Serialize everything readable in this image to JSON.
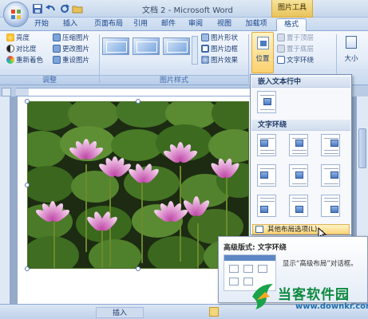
{
  "window": {
    "title": "文档 2 - Microsoft Word",
    "contextual_tab_group": "图片工具"
  },
  "quick_access": [
    "save-icon",
    "undo-icon",
    "redo-icon",
    "open-icon"
  ],
  "tabs": [
    {
      "label": "开始",
      "active": false
    },
    {
      "label": "插入",
      "active": false
    },
    {
      "label": "页面布局",
      "active": false
    },
    {
      "label": "引用",
      "active": false
    },
    {
      "label": "邮件",
      "active": false
    },
    {
      "label": "审阅",
      "active": false
    },
    {
      "label": "视图",
      "active": false
    },
    {
      "label": "加载项",
      "active": false
    },
    {
      "label": "格式",
      "active": true
    }
  ],
  "ribbon": {
    "adjust": {
      "label": "调整",
      "brightness": "亮度",
      "contrast": "对比度",
      "recolor": "重新着色",
      "compress": "压缩图片",
      "change_picture": "更改图片",
      "reset_picture": "重设图片"
    },
    "picture_styles": {
      "label": "图片样式",
      "shape": "图片形状",
      "border": "图片边框",
      "effects": "图片效果"
    },
    "arrange": {
      "position": "位置",
      "bring_to_front": "置于顶层",
      "send_to_back": "置于底层",
      "text_wrapping": "文字环绕"
    },
    "size": {
      "label": "大小"
    }
  },
  "position_menu": {
    "inline_header": "嵌入文本行中",
    "wrap_header": "文字环绕",
    "more_layout": "其他布局选项(L)..."
  },
  "tooltip": {
    "title": "高级版式: 文字环绕",
    "description": "显示“高级布局”对话框。"
  },
  "status": {
    "insert_mode": "插入"
  },
  "watermark": {
    "site_name": "当客软件园",
    "url": "www.downkr.com"
  },
  "colors": {
    "ribbon_blue": "#15428b",
    "contextual_tab": "#e9c35c",
    "watermark_green": "#0d8a3f",
    "watermark_blue": "#1d6fb0"
  }
}
